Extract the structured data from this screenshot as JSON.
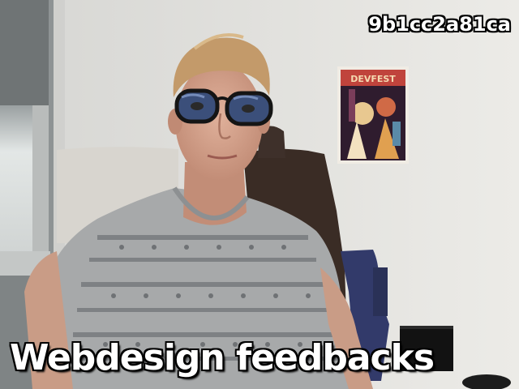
{
  "overlay": {
    "caption": "Webdesign feedbacks",
    "hash": "9b1cc2a81ca"
  },
  "poster": {
    "title": "DEVFEST"
  },
  "colors": {
    "wall": "#e4e3df",
    "window_frame": "#a9acab",
    "chair": "#3a2c25",
    "shirt": "#a7a9aa",
    "skin": "#d9a68e",
    "hair": "#c39a6a",
    "glasses": "#151515",
    "poster_bg": "#2f1c2e"
  }
}
